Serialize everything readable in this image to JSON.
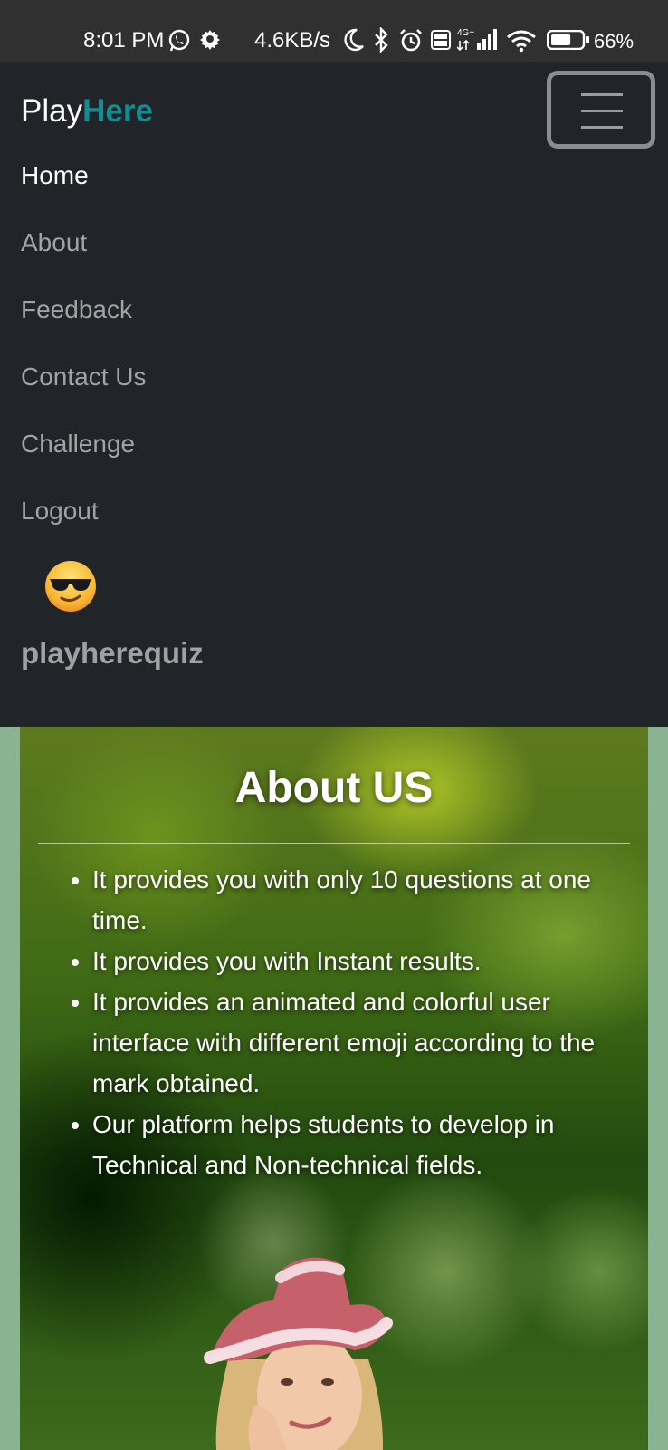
{
  "status_bar": {
    "time": "8:01 PM",
    "net_speed": "4.6KB/s",
    "battery_pct": "66%",
    "battery_level": 0.66,
    "icons": [
      "whatsapp-icon",
      "gear-icon",
      "moon-icon",
      "bluetooth-icon",
      "alarm-icon",
      "volte-icon",
      "signal-4g-icon",
      "wifi-icon",
      "battery-icon"
    ]
  },
  "navbar": {
    "brand_plain": "Play",
    "brand_accent": "Here",
    "links": [
      {
        "label": "Home",
        "active": true
      },
      {
        "label": "About",
        "active": false
      },
      {
        "label": "Feedback",
        "active": false
      },
      {
        "label": "Contact Us",
        "active": false
      },
      {
        "label": "Challenge",
        "active": false
      },
      {
        "label": "Logout",
        "active": false
      }
    ],
    "avatar_icon": "smiling-face-with-sunglasses-icon",
    "username": "playherequiz"
  },
  "about": {
    "title": "About US",
    "points": [
      "It provides you with only 10 questions at one time.",
      "It provides you with Instant results.",
      "It provides an animated and colorful user interface with different emoji according to the mark obtained.",
      "Our platform helps students to develop in Technical and Non-technical fields."
    ]
  },
  "colors": {
    "navbar_bg": "#212429",
    "brand_accent": "#108e91",
    "statusbar_bg": "#303030",
    "page_bg": "#8ab391"
  }
}
